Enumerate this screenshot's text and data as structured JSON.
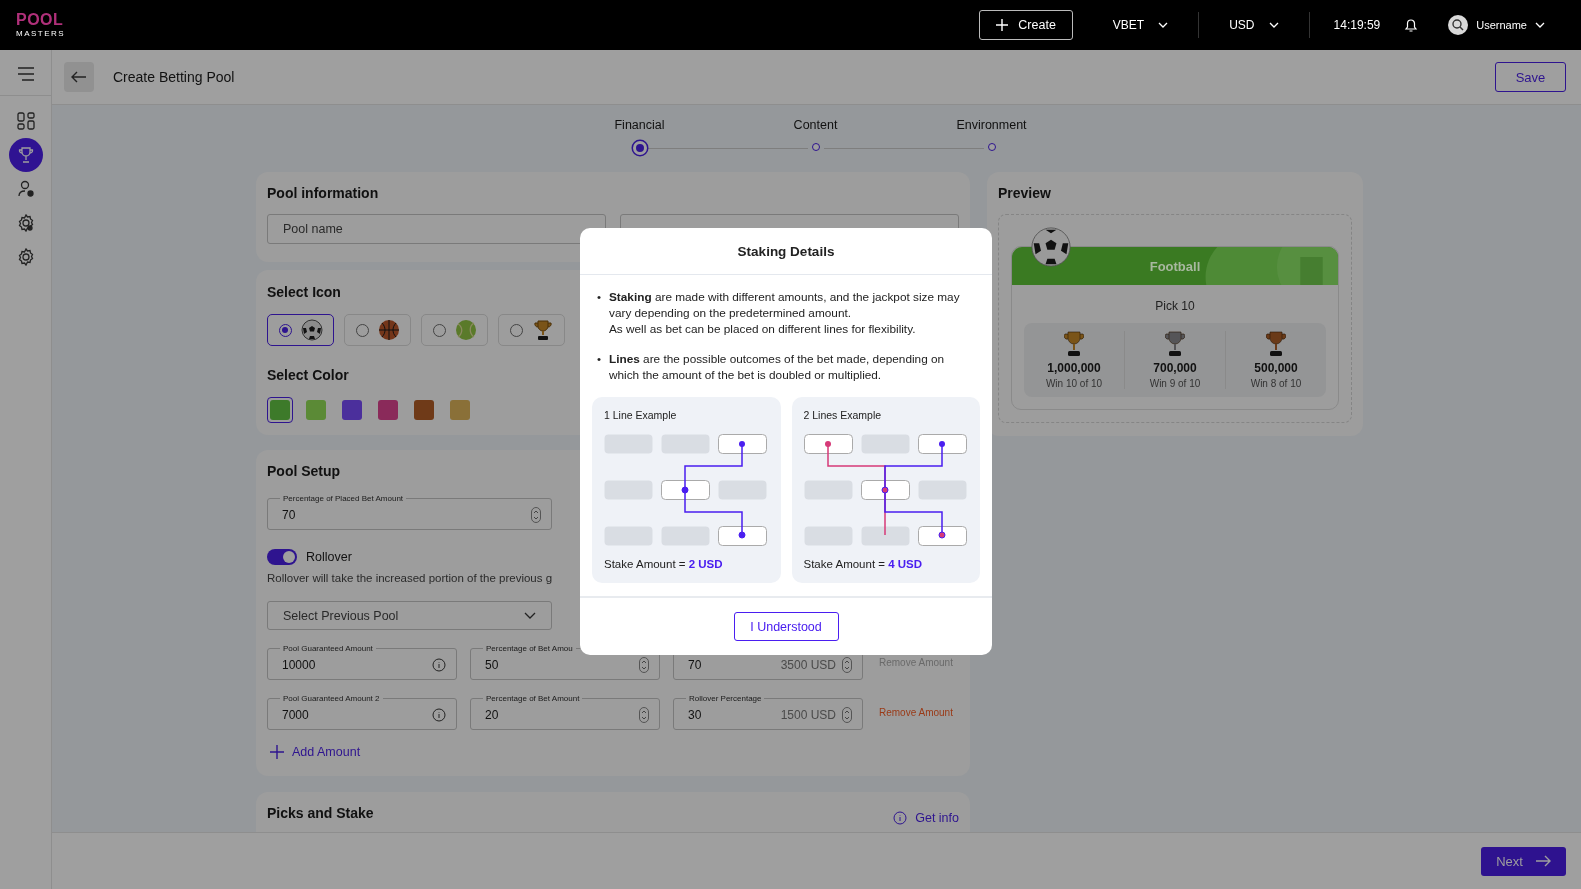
{
  "logo": {
    "top": "POOL",
    "bottom": "MASTERS"
  },
  "topbar": {
    "create": "Create",
    "brand": "VBET",
    "currency": "USD",
    "time": "14:19:59",
    "username": "Username"
  },
  "sidebar": {
    "items": [
      {
        "kind": "grid",
        "selected": false
      },
      {
        "kind": "trophy",
        "selected": true
      },
      {
        "kind": "user-gear",
        "selected": false
      },
      {
        "kind": "gear-user",
        "selected": false
      },
      {
        "kind": "gear",
        "selected": false
      }
    ]
  },
  "page": {
    "title": "Create Betting Pool",
    "save": "Save"
  },
  "stepper": {
    "steps": [
      {
        "label": "Financial",
        "selected": true
      },
      {
        "label": "Content",
        "selected": false
      },
      {
        "label": "Environment",
        "selected": false
      }
    ]
  },
  "pool_information": {
    "title": "Pool information",
    "name_placeholder": "Pool name"
  },
  "select_icon": {
    "title": "Select Icon",
    "options": [
      {
        "kind": "soccer",
        "selected": true
      },
      {
        "kind": "basketball",
        "selected": false
      },
      {
        "kind": "tennis",
        "selected": false
      },
      {
        "kind": "trophy",
        "selected": false
      }
    ]
  },
  "select_color": {
    "title": "Select Color",
    "swatches": [
      {
        "color": "#3d7a2a",
        "selected": true
      },
      {
        "color": "#5b8a36",
        "selected": false
      },
      {
        "color": "#4b2f9c",
        "selected": false
      },
      {
        "color": "#8a2a5a",
        "selected": false
      },
      {
        "color": "#6f3a18",
        "selected": false
      },
      {
        "color": "#8a7038",
        "selected": false
      }
    ]
  },
  "pool_setup": {
    "title": "Pool Setup",
    "percentage": {
      "label": "Percentage of Placed Bet Amount",
      "value": "70"
    },
    "rollover": {
      "label": "Rollover",
      "on": true,
      "description": "Rollover will take the increased portion of the previous g"
    },
    "previous_pool": {
      "placeholder": "Select Previous Pool"
    },
    "amounts": [
      {
        "guaranteed_label": "Pool Guaranteed Amount",
        "guaranteed": "10000",
        "bet_label": "Percentage of Bet Amou",
        "bet": "50",
        "rollover_value": "70",
        "rollover_usd": "3500 USD",
        "remove": "Remove Amount",
        "disabled": true
      },
      {
        "guaranteed_label": "Pool Guaranteed Amount 2",
        "guaranteed": "7000",
        "bet_label": "Percentage of Bet Amount",
        "bet": "20",
        "rollover_label": "Rollover Percentage",
        "rollover_value": "30",
        "rollover_usd": "1500 USD",
        "remove": "Remove Amount",
        "disabled": false
      }
    ],
    "add": "Add Amount"
  },
  "picks_and_stake": {
    "title": "Picks and Stake",
    "info": "Get info"
  },
  "preview": {
    "title": "Preview",
    "banner": "Football",
    "pick": "Pick 10",
    "prizes": [
      {
        "kind": "gold",
        "amount": "1,000,000",
        "caption": "Win 10 of 10"
      },
      {
        "kind": "silver",
        "amount": "700,000",
        "caption": "Win 9 of 10"
      },
      {
        "kind": "bronze",
        "amount": "500,000",
        "caption": "Win 8 of 10"
      }
    ]
  },
  "modal": {
    "title": "Staking Details",
    "bullets": [
      {
        "marker": "•",
        "text": "**Staking** are made with different amounts, and the jackpot size may vary depending on the predetermined amount.\nAs well as bet can be placed on different lines for flexibility."
      },
      {
        "marker": "•",
        "text": "**Lines** are the possible outcomes of the bet made, depending on which the amount of the bet is doubled or multiplied."
      }
    ],
    "examples": [
      {
        "kind": "single",
        "title": "1 Line Example",
        "stake_label": "Stake Amount =",
        "stake_value": "2 USD"
      },
      {
        "kind": "double",
        "title": "2 Lines Example",
        "stake_label": "Stake Amount =",
        "stake_value": "4 USD"
      }
    ],
    "button": "I Understood"
  },
  "footer": {
    "next": "Next"
  }
}
